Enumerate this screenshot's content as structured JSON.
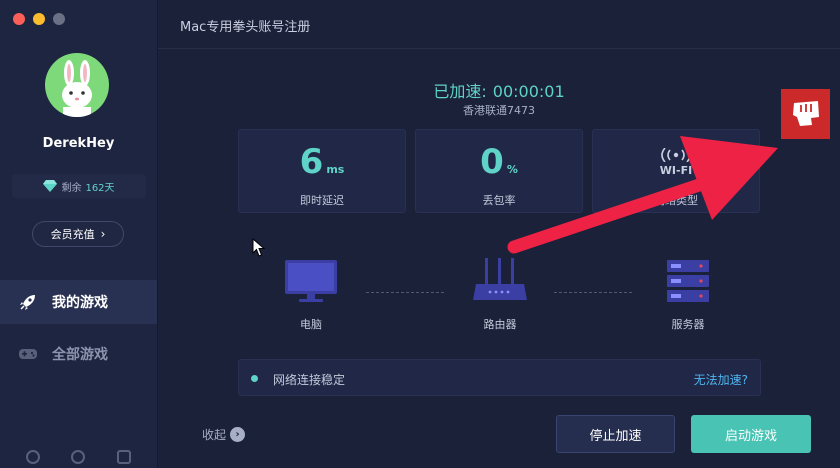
{
  "window": {
    "title": "Mac专用拳头账号注册"
  },
  "sidebar": {
    "username": "DerekHey",
    "vip": {
      "prefix": "剩余",
      "days": "162天"
    },
    "recharge_label": "会员充值",
    "nav": [
      {
        "label": "我的游戏",
        "icon": "rocket-icon",
        "active": true
      },
      {
        "label": "全部游戏",
        "icon": "gamepad-icon",
        "active": false
      }
    ],
    "bottom_icons": [
      "headset-icon",
      "settings-icon",
      "ticket-icon"
    ]
  },
  "main": {
    "timer_label": "已加速:",
    "timer_value": "00:00:01",
    "server": "香港联通7473",
    "stats": [
      {
        "value": "6",
        "unit": "ms",
        "label": "即时延迟"
      },
      {
        "value": "0",
        "unit": "%",
        "label": "丢包率"
      },
      {
        "value": "WI-FI",
        "unit": "",
        "label": "网络类型"
      }
    ],
    "devices": [
      {
        "label": "电脑",
        "icon": "monitor-icon"
      },
      {
        "label": "路由器",
        "icon": "router-icon"
      },
      {
        "label": "服务器",
        "icon": "server-icon"
      }
    ],
    "status_text": "网络连接稳定",
    "status_link": "无法加速?",
    "collapse_label": "收起",
    "stop_button": "停止加速",
    "start_button": "启动游戏"
  },
  "colors": {
    "accent": "#5fd3c8",
    "start_button": "#49c4b4",
    "link": "#4fb6f0",
    "logo_badge": "#cc2a2a",
    "annotation_arrow": "#ee2244"
  }
}
